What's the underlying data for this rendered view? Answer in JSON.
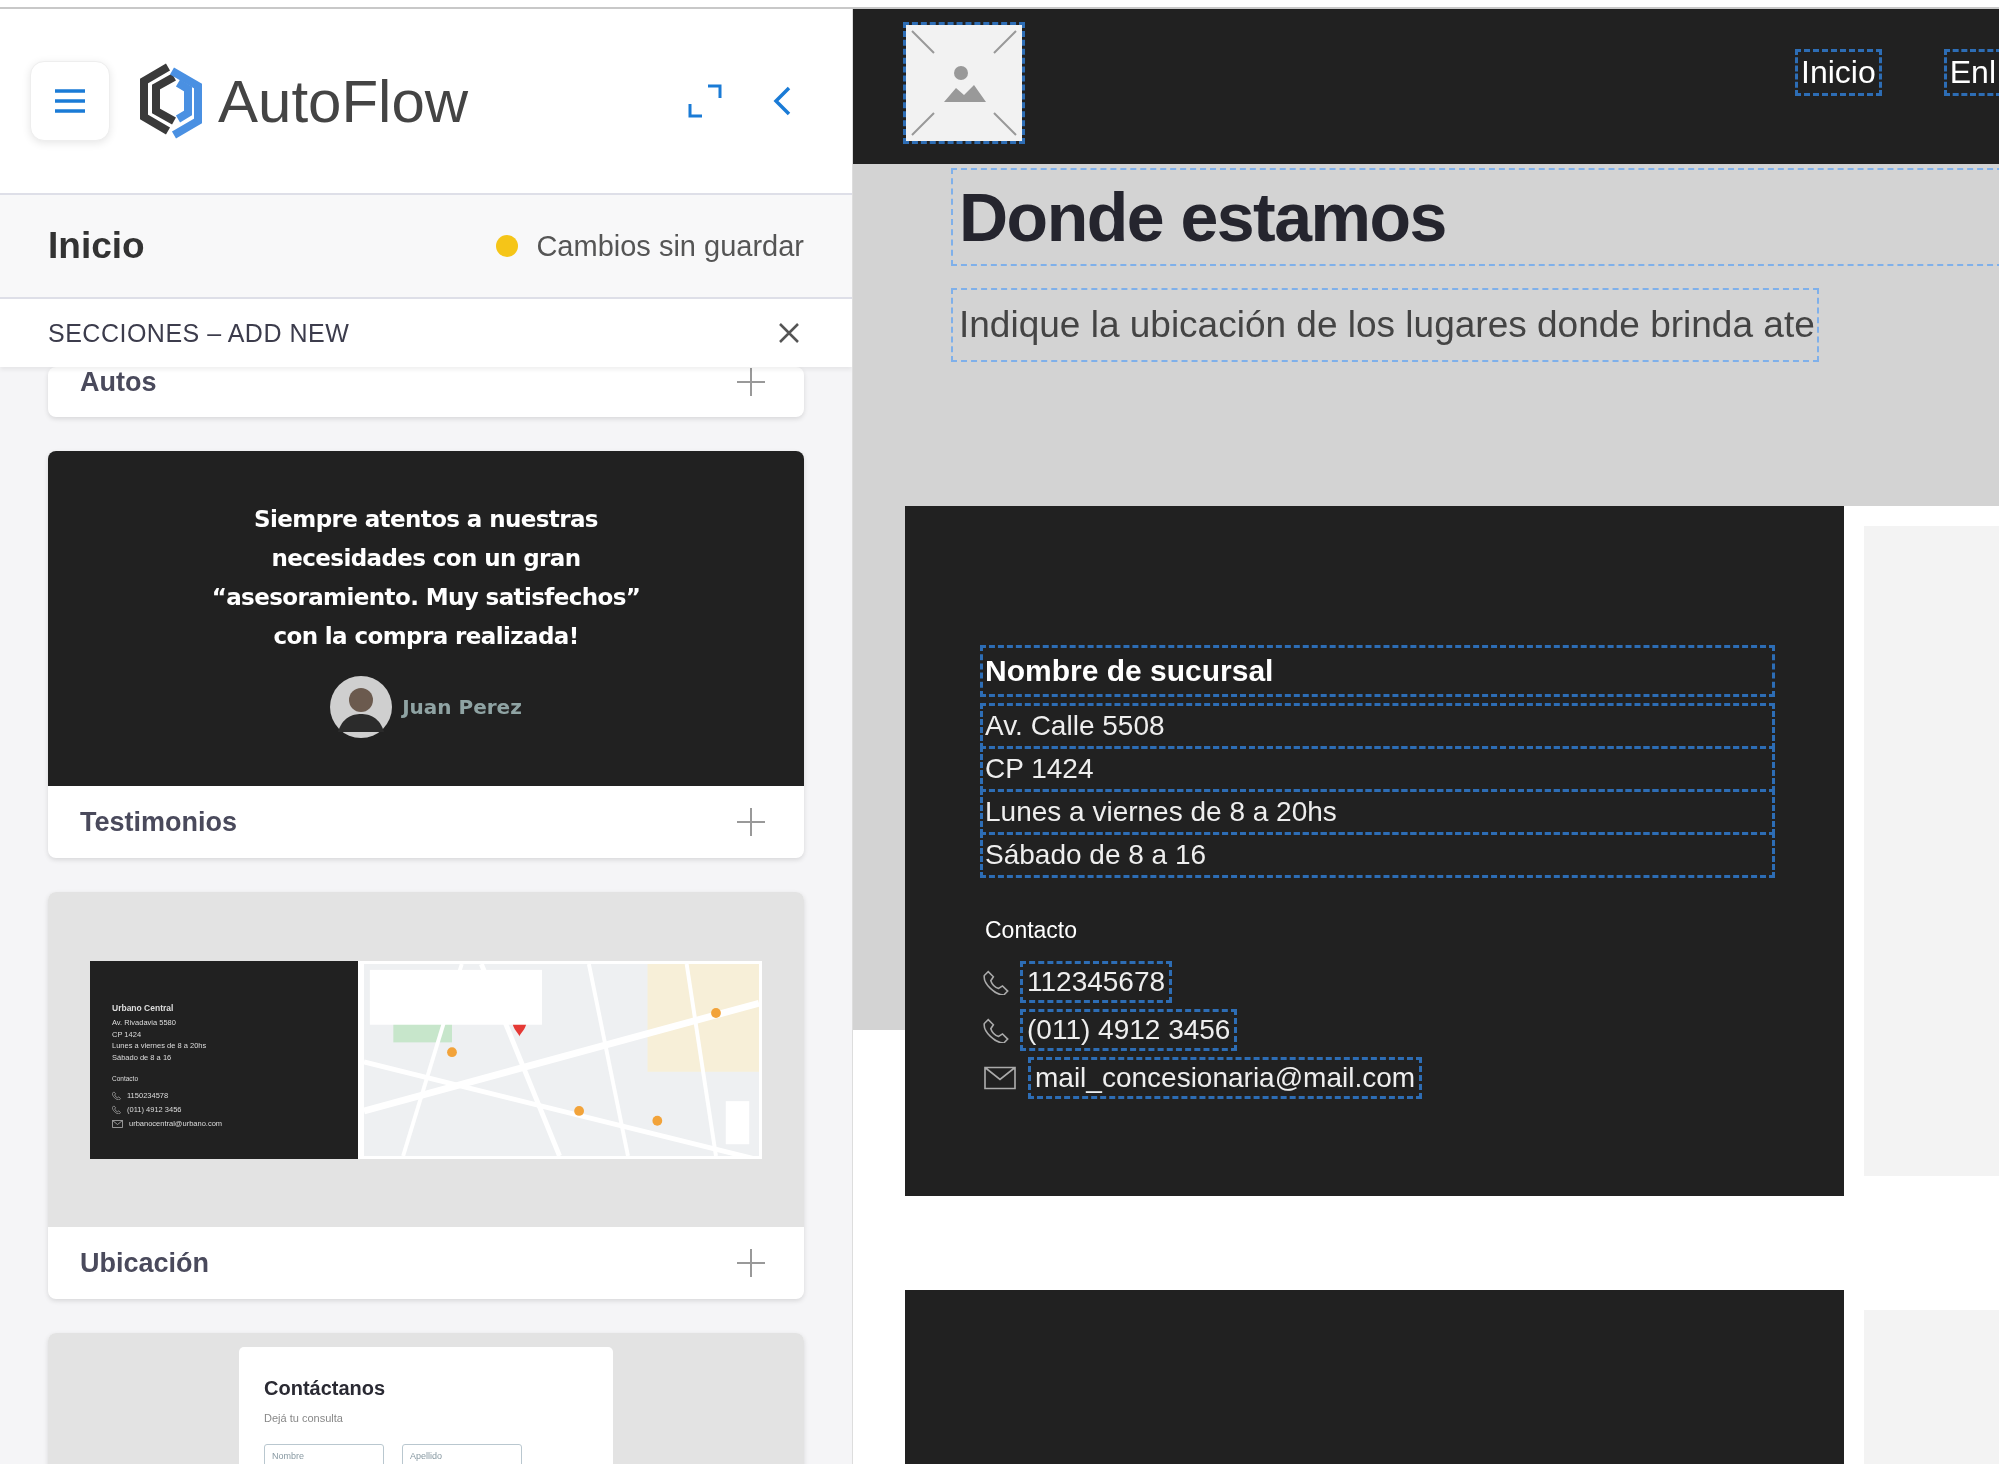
{
  "sidebar": {
    "brand": "**Auto**Flow",
    "page": {
      "title": "Inicio",
      "status": "Cambios sin guardar",
      "unsaved": true
    },
    "panel": {
      "title": "SECCIONES – ADD NEW"
    },
    "sections": [
      {
        "kind": "plain",
        "name": "Autos"
      },
      {
        "kind": "testimonial",
        "name": "Testimonios",
        "quote": "Siempre atentos a nuestras\nnecesidades con un gran\n“asesoramiento. Muy satisfechos”\ncon la compra realizada!",
        "author": "Juan Perez"
      },
      {
        "kind": "location",
        "name": "Ubicación",
        "branch": {
          "name": "Urbano Central",
          "lines": [
            "Av. Rivadavia 5580",
            "CP 1424",
            "Lunes a viernes de 8 a 20hs",
            "Sábado de 8 a 16"
          ],
          "contact_label": "Contacto",
          "contacts": [
            {
              "kind": "phone",
              "text": "1150234578"
            },
            {
              "kind": "phone",
              "text": "(011) 4912 3456"
            },
            {
              "kind": "email",
              "text": "urbanocentral@urbano.com"
            }
          ]
        }
      },
      {
        "kind": "contact",
        "heading": "Contáctanos",
        "subheading": "Dejá tu consulta",
        "fields": [
          {
            "placeholder": "Nombre"
          },
          {
            "placeholder": "Apellido"
          }
        ]
      }
    ]
  },
  "preview": {
    "nav": [
      {
        "label": "Inicio"
      },
      {
        "label": "Enl"
      }
    ],
    "heading": "Donde estamos",
    "subheading": "Indique la ubicación de los lugares donde brinda ate",
    "branch": {
      "name": "Nombre de sucursal",
      "lines": [
        "Av. Calle 5508",
        "CP 1424",
        "Lunes a viernes de 8 a 20hs",
        "Sábado de 8 a 16"
      ],
      "contact_label": "Contacto",
      "contacts": [
        {
          "kind": "phone",
          "text": "112345678"
        },
        {
          "kind": "phone",
          "text": "(011) 4912 3456"
        },
        {
          "kind": "email",
          "text": "mail_concesionaria@mail.com"
        }
      ]
    }
  }
}
